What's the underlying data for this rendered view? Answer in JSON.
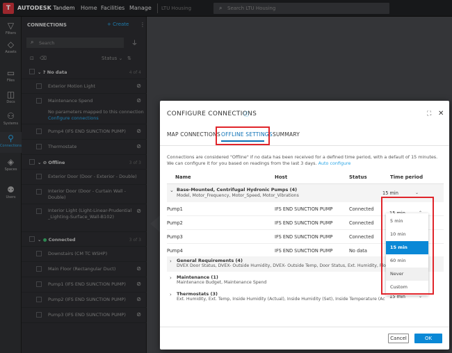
{
  "topbar": {
    "logo": "T",
    "brand_bold": "AUTODESK",
    "brand_rest": "Tandem",
    "nav": [
      "Home",
      "Facilities",
      "Manage"
    ],
    "facility": "LTU Housing",
    "search_placeholder": "Search LTU Housing"
  },
  "rail": [
    {
      "label": "Filters",
      "icon": "filter-icon",
      "glyph": "▽"
    },
    {
      "label": "Assets",
      "icon": "tag-icon",
      "glyph": "◇"
    },
    {
      "label": "Files",
      "icon": "file-icon",
      "glyph": "▭"
    },
    {
      "label": "Docs",
      "icon": "document-icon",
      "glyph": "◫"
    },
    {
      "label": "Systems",
      "icon": "systems-icon",
      "glyph": "⚇"
    },
    {
      "label": "Connections",
      "icon": "connections-icon",
      "glyph": "⚲"
    },
    {
      "label": "Spaces",
      "icon": "layers-icon",
      "glyph": "◈"
    },
    {
      "label": "Users",
      "icon": "users-icon",
      "glyph": "⚉"
    }
  ],
  "panel": {
    "title": "CONNECTIONS",
    "create": "+ Create",
    "search_placeholder": "Search",
    "status_label": "Status",
    "groups": [
      {
        "name": "No data",
        "count": "4 of 4",
        "icon": "question-icon"
      },
      {
        "name": "Offline",
        "count": "3 of 3",
        "icon": "offline-icon"
      },
      {
        "name": "Connected",
        "count": "3 of 3",
        "icon": "check-icon"
      }
    ],
    "items_nodata": [
      "Exterior Motion Light",
      "Maintenance Spend",
      "Pump4 (IFS END SUNCTION PUMP)",
      "Thermostate"
    ],
    "no_params": "No parameters mapped to this connection",
    "configure": "Configure connections",
    "items_offline": [
      "Exterior Door (Door - Exterior - Double)",
      "Interior Door (Door - Curtain Wall - Double)",
      "Interior Light (Light-Linear-Prudential_Lighting-Surface_Wall-B102)"
    ],
    "items_connected": [
      "Downstairs (CM TC WSHP)",
      "Main Floor (Rectangular Duct)",
      "Pump1 (IFS END SUNCTION PUMP)",
      "Pump2 (IFS END SUNCTION PUMP)",
      "Pump3 (IFS END SUNCTION PUMP)"
    ]
  },
  "dialog": {
    "title": "CONFIGURE CONNECTIONS",
    "tabs": [
      "MAP CONNECTIONS",
      "OFFLINE SETTINGS",
      "SUMMARY"
    ],
    "active_tab": 1,
    "description": "Connections are considered \"Offline\" if no data has been received for a defined time period, with a default of 15 minutes. We can configure it for you based on readings from the last 3 days.",
    "auto_configure": "Auto configure",
    "columns": [
      "Name",
      "Host",
      "Status",
      "Time period"
    ],
    "group1": {
      "name": "Base-Mounted, Centrifugal Hydronic Pumps (4)",
      "desc": "Model, Motor_Frequency, Motor_Speed, Motor_Vibrations",
      "period": "15 min"
    },
    "rows": [
      {
        "name": "Pump1",
        "host": "IFS END SUNCTION PUMP",
        "status": "Connected",
        "period": "15 min"
      },
      {
        "name": "Pump2",
        "host": "IFS END SUNCTION PUMP",
        "status": "Connected",
        "period": ""
      },
      {
        "name": "Pump3",
        "host": "IFS END SUNCTION PUMP",
        "status": "Connected",
        "period": ""
      },
      {
        "name": "Pump4",
        "host": "IFS END SUNCTION PUMP",
        "status": "No data",
        "period": ""
      }
    ],
    "groups": [
      {
        "name": "General Requirements (4)",
        "desc": "DVEX Door Status, DVEX- Outside Humidity, DVEX- Outside Temp, Door Status, Ext. Humidity, Flow (GPM)"
      },
      {
        "name": "Maintenance (1)",
        "desc": "Maintenance Budget, Maintenance Spend"
      },
      {
        "name": "Thermostats (3)",
        "desc": "Ext. Humidity, Ext. Temp, Inside Humidity (Actual), Inside Humidity (Set), Inside Temperature (Actual)...",
        "period": "15 min"
      }
    ],
    "dropdown_options": [
      "5 min",
      "10 min",
      "15 min",
      "60 min",
      "Never",
      "Custom"
    ],
    "dropdown_selected": "15 min",
    "cancel": "Cancel",
    "ok": "OK"
  },
  "colors": {
    "accent": "#0a88d6",
    "highlight_box": "#e0242a",
    "logo": "#d1343c"
  }
}
